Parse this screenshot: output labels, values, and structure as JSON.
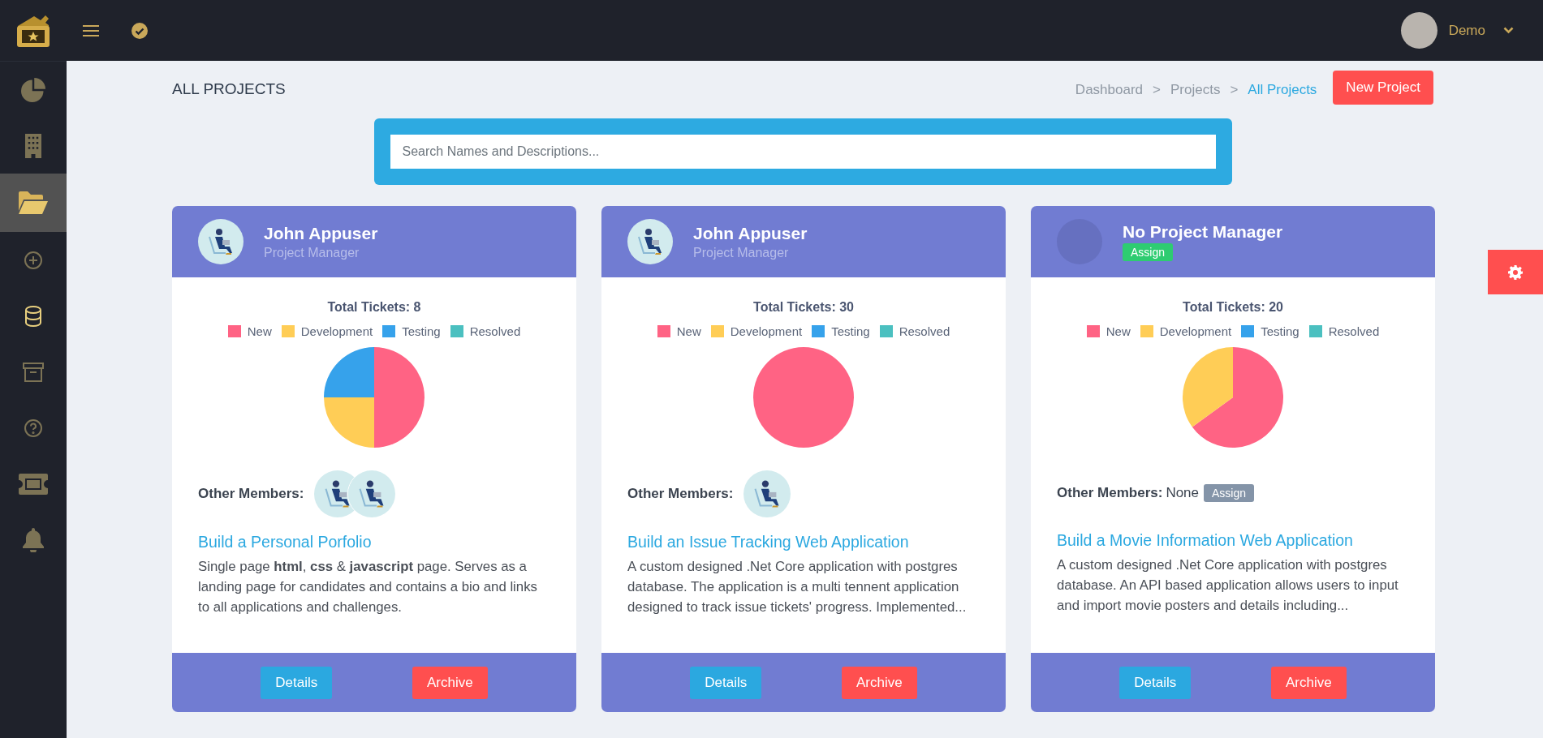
{
  "sidebar": {
    "items": [
      {
        "selected": false
      },
      {
        "selected": false
      },
      {
        "selected": true
      },
      {
        "selected": false
      },
      {
        "selected": false
      },
      {
        "selected": false
      },
      {
        "selected": false
      },
      {
        "selected": false
      },
      {
        "selected": false
      }
    ]
  },
  "topbar": {
    "user": "Demo"
  },
  "page": {
    "title": "ALL PROJECTS",
    "breadcrumb": [
      {
        "label": "Dashboard",
        "kind": "link",
        "selected": false
      },
      {
        "label": ">",
        "kind": "separator"
      },
      {
        "label": "Projects",
        "kind": "link",
        "selected": false
      },
      {
        "label": ">",
        "kind": "separator"
      },
      {
        "label": "All Projects",
        "kind": "link",
        "selected": true
      }
    ],
    "new_button": "New Project"
  },
  "search": {
    "placeholder": "Search Names and Descriptions..."
  },
  "projects": [
    {
      "manager": {
        "kind": "user",
        "name": "John Appuser",
        "role": "Project Manager"
      },
      "chart_data": {
        "type": "pie",
        "title": "Total Tickets: 8",
        "categories": [
          "New",
          "Development",
          "Testing",
          "Resolved"
        ],
        "colors": [
          "#ff6384",
          "#ffcd56",
          "#36a2eb",
          "#4bc0c0"
        ],
        "values": [
          50,
          25,
          25,
          0
        ],
        "legend": "top"
      },
      "members_label": "Other Members:",
      "members": [
        {
          "kind": "avatar"
        },
        {
          "kind": "avatar"
        }
      ],
      "name": "Build a Personal Porfolio",
      "description": "Single page **html**, **css** & **javascript** page. Serves as a landing page for candidates and contains a bio and links to all applications and challenges.",
      "details": "Details",
      "archive": "Archive"
    },
    {
      "manager": {
        "kind": "user",
        "name": "John Appuser",
        "role": "Project Manager"
      },
      "chart_data": {
        "type": "pie",
        "title": "Total Tickets: 30",
        "categories": [
          "New",
          "Development",
          "Testing",
          "Resolved"
        ],
        "colors": [
          "#ff6384",
          "#ffcd56",
          "#36a2eb",
          "#4bc0c0"
        ],
        "values": [
          100,
          0,
          0,
          0
        ],
        "legend": "top"
      },
      "members_label": "Other Members:",
      "members": [
        {
          "kind": "avatar"
        }
      ],
      "name": "Build an Issue Tracking Web Application",
      "description": "A custom designed .Net Core application with postgres database. The application is a multi tennent application designed to track issue tickets' progress. Implemented...",
      "details": "Details",
      "archive": "Archive"
    },
    {
      "manager": {
        "kind": "none",
        "name": "No Project Manager",
        "assign": "Assign"
      },
      "chart_data": {
        "type": "pie",
        "title": "Total Tickets: 20",
        "categories": [
          "New",
          "Development",
          "Testing",
          "Resolved"
        ],
        "colors": [
          "#ff6384",
          "#ffcd56",
          "#36a2eb",
          "#4bc0c0"
        ],
        "values": [
          65,
          35,
          0,
          0
        ],
        "legend": "top"
      },
      "members_label": "Other Members:",
      "members_none": "None",
      "members_assign": "Assign",
      "name": "Build a Movie Information Web Application",
      "description": "A custom designed .Net Core application with postgres database. An API based application allows users to input and import movie posters and details including...",
      "details": "Details",
      "archive": "Archive"
    }
  ]
}
